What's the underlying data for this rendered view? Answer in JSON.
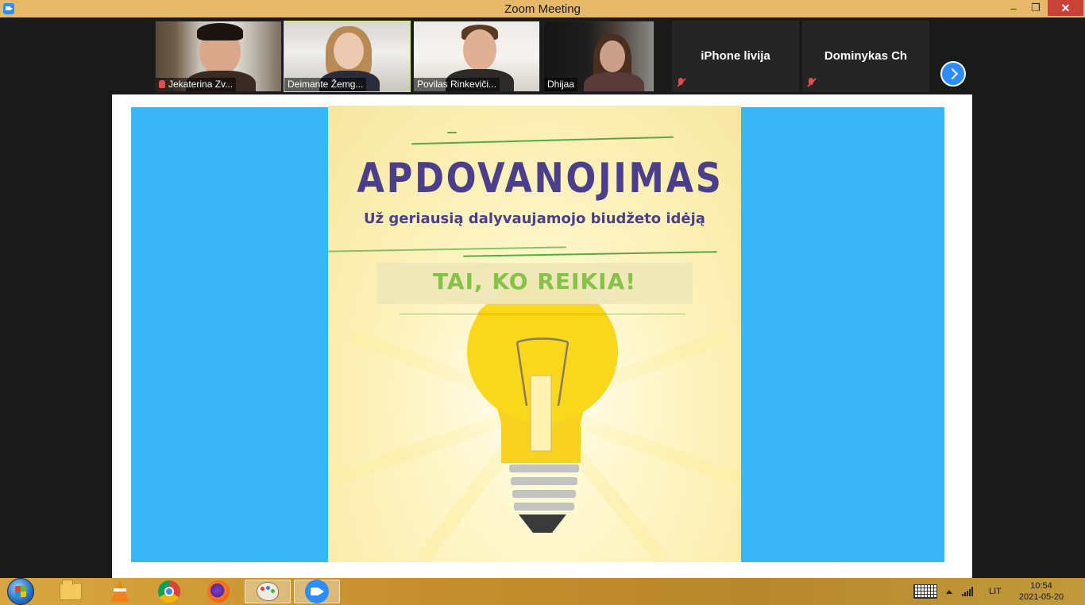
{
  "window": {
    "title": "Zoom Meeting",
    "min_label": "–",
    "max_label": "❐",
    "close_label": "✕"
  },
  "participants": [
    {
      "name": "Jekaterina Zv...",
      "type": "video",
      "muted": true
    },
    {
      "name": "Deimante Žemg...",
      "type": "video",
      "muted": false,
      "active_speaker": true
    },
    {
      "name": "Povilas Rinkeviči...",
      "type": "video",
      "muted": false
    },
    {
      "name": "Dhijaa",
      "type": "video",
      "muted": false
    },
    {
      "name": "iPhone livija",
      "type": "audio",
      "muted": true
    },
    {
      "name": "Dominykas Ch",
      "type": "audio",
      "muted": true
    }
  ],
  "poster": {
    "title": "APDOVANOJIMAS",
    "subtitle": "Už geriausią dalyvaujamojo biudžeto idėją",
    "banner": "TAI, KO REIKIA!"
  },
  "colors": {
    "slide_bg": "#38b6f5",
    "poster_title": "#4b3f8c",
    "banner_text": "#86c24a",
    "titlebar": "#e6b86a",
    "zoom_blue": "#2d8cff"
  },
  "taskbar": {
    "items": [
      "start-orb",
      "folder-icon",
      "vlc-icon",
      "chrome-icon",
      "firefox-icon",
      "paint-icon",
      "zoom-icon"
    ],
    "language": "LIT",
    "time": "10:54",
    "date": "2021-05-20"
  }
}
